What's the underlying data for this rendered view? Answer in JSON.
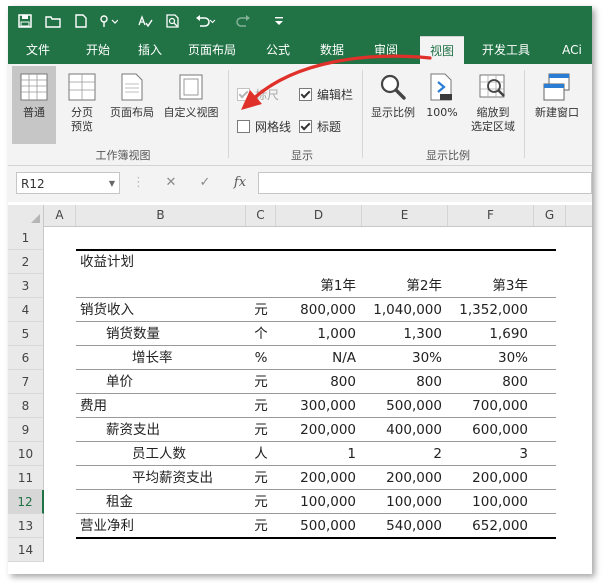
{
  "tabs": [
    {
      "label": "文件",
      "active": false
    },
    {
      "label": "开始",
      "active": false
    },
    {
      "label": "插入",
      "active": false
    },
    {
      "label": "页面布局",
      "active": false
    },
    {
      "label": "公式",
      "active": false
    },
    {
      "label": "数据",
      "active": false
    },
    {
      "label": "审阅",
      "active": false
    },
    {
      "label": "视图",
      "active": true
    },
    {
      "label": "开发工具",
      "active": false
    },
    {
      "label": "ACi",
      "active": false
    }
  ],
  "ribbon": {
    "normal_label": "普通",
    "page_break_label_1": "分页",
    "page_break_label_2": "预览",
    "page_layout_label": "页面布局",
    "custom_view_label": "自定义视图",
    "group_workbook_views": "工作簿视图",
    "ruler_label": "标尺",
    "gridlines_label": "网格线",
    "formula_bar_label": "编辑栏",
    "headings_label": "标题",
    "group_show": "显示",
    "zoom_label": "显示比例",
    "zoom100_label": "100%",
    "zoom_selection_label_1": "缩放到",
    "zoom_selection_label_2": "选定区域",
    "group_zoom": "显示比例",
    "new_window_label": "新建窗口",
    "ruler_checked": true,
    "gridlines_checked": false,
    "formula_bar_checked": true,
    "headings_checked": true
  },
  "formula_bar": {
    "name_box": "R12",
    "fx": "fx",
    "cancel": "✕",
    "enter": "✓",
    "value": ""
  },
  "columns": [
    "A",
    "B",
    "C",
    "D",
    "E",
    "F",
    "G"
  ],
  "rows": [
    "1",
    "2",
    "3",
    "4",
    "5",
    "6",
    "7",
    "8",
    "9",
    "10",
    "11",
    "12",
    "13",
    "14"
  ],
  "selected_row": "12",
  "sheet": {
    "title": "收益计划",
    "headers": [
      "第1年",
      "第2年",
      "第3年"
    ],
    "lines": [
      {
        "label": "销货收入",
        "unit": "元",
        "y1": "800,000",
        "y2": "1,040,000",
        "y3": "1,352,000"
      },
      {
        "label": "销货数量",
        "unit": "个",
        "y1": "1,000",
        "y2": "1,300",
        "y3": "1,690"
      },
      {
        "label": "增长率",
        "unit": "%",
        "y1": "N/A",
        "y2": "30%",
        "y3": "30%"
      },
      {
        "label": "单价",
        "unit": "元",
        "y1": "800",
        "y2": "800",
        "y3": "800"
      },
      {
        "label": "费用",
        "unit": "元",
        "y1": "300,000",
        "y2": "500,000",
        "y3": "700,000"
      },
      {
        "label": "薪资支出",
        "unit": "元",
        "y1": "200,000",
        "y2": "400,000",
        "y3": "600,000"
      },
      {
        "label": "员工人数",
        "unit": "人",
        "y1": "1",
        "y2": "2",
        "y3": "3"
      },
      {
        "label": "平均薪资支出",
        "unit": "元",
        "y1": "200,000",
        "y2": "200,000",
        "y3": "200,000"
      },
      {
        "label": "租金",
        "unit": "元",
        "y1": "100,000",
        "y2": "100,000",
        "y3": "100,000"
      },
      {
        "label": "营业净利",
        "unit": "元",
        "y1": "500,000",
        "y2": "540,000",
        "y3": "652,000"
      }
    ]
  },
  "colors": {
    "excel_green": "#217346",
    "arrow_red": "#e0302a"
  }
}
